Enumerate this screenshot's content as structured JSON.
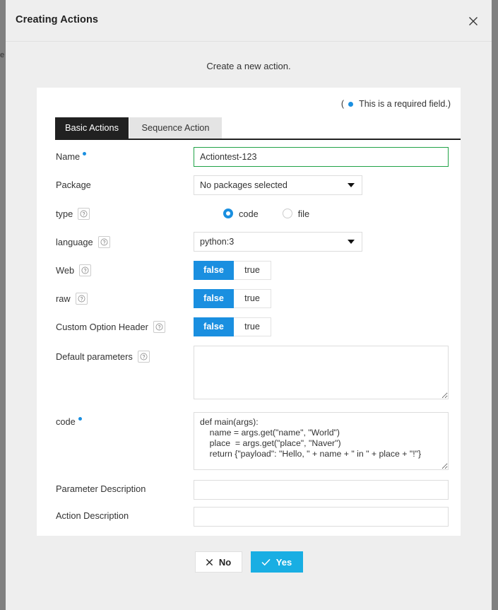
{
  "modal": {
    "title": "Creating Actions",
    "close_icon": "close-icon",
    "subtitle": "Create a new action."
  },
  "card": {
    "required_note": {
      "open_paren": "(",
      "text": "This is a required field.)"
    },
    "tabs": [
      {
        "label": "Basic Actions",
        "active": true
      },
      {
        "label": "Sequence Action",
        "active": false
      }
    ]
  },
  "form": {
    "name": {
      "label": "Name",
      "value": "Actiontest-123",
      "placeholder": ""
    },
    "package": {
      "label": "Package",
      "value": "No packages selected"
    },
    "type": {
      "label": "type",
      "options": [
        "code",
        "file"
      ],
      "selected": "code"
    },
    "language": {
      "label": "language",
      "value": "python:3"
    },
    "web": {
      "label": "Web",
      "options": [
        "false",
        "true"
      ],
      "selected": "false"
    },
    "raw": {
      "label": "raw",
      "options": [
        "false",
        "true"
      ],
      "selected": "false"
    },
    "custom_option_header": {
      "label": "Custom Option Header",
      "options": [
        "false",
        "true"
      ],
      "selected": "false"
    },
    "default_parameters": {
      "label": "Default parameters",
      "value": "",
      "placeholder": ""
    },
    "code": {
      "label": "code",
      "value": "def main(args):\n    name = args.get(\"name\", \"World\")\n    place  = args.get(\"place\", \"Naver\")\n    return {\"payload\": \"Hello, \" + name + \" in \" + place + \"!\"}",
      "placeholder": ""
    },
    "parameter_description": {
      "label": "Parameter Description",
      "value": "",
      "placeholder": ""
    },
    "action_description": {
      "label": "Action Description",
      "value": "",
      "placeholder": ""
    }
  },
  "footer": {
    "no_label": "No",
    "yes_label": "Yes"
  },
  "colors": {
    "accent_blue": "#1a8fe0",
    "yes_blue": "#19aee3",
    "valid_green": "#21a347",
    "tab_active_bg": "#212121"
  }
}
